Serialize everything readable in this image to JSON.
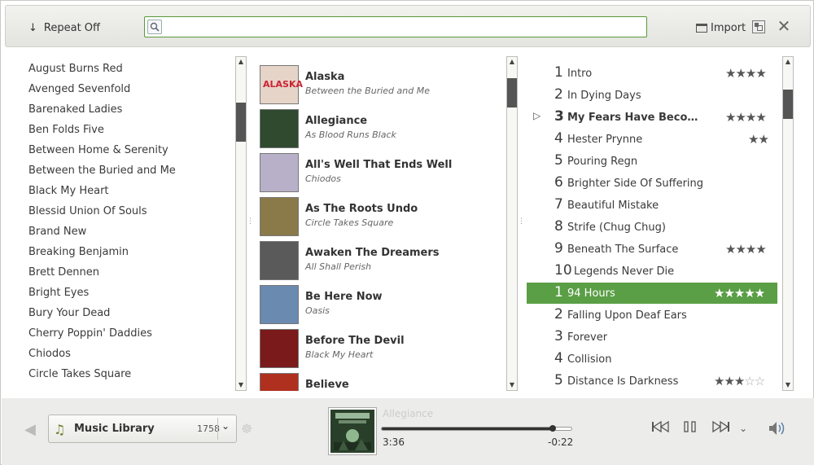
{
  "toolbar": {
    "repeat_label": "Repeat Off",
    "search_placeholder": "",
    "import_label": "Import"
  },
  "artists": [
    "August Burns Red",
    "Avenged Sevenfold",
    "Barenaked Ladies",
    "Ben Folds Five",
    "Between Home & Serenity",
    "Between the Buried and Me",
    "Black My Heart",
    "Blessid Union Of Souls",
    "Brand New",
    "Breaking Benjamin",
    "Brett Dennen",
    "Bright Eyes",
    "Bury Your Dead",
    "Cherry Poppin' Daddies",
    "Chiodos",
    "Circle Takes Square"
  ],
  "albums": [
    {
      "name": "Alaska",
      "artist": "Between the Buried and Me",
      "cover_color": "#e6d4c8",
      "cover_text": "ALASKA"
    },
    {
      "name": "Allegiance",
      "artist": "As Blood Runs Black",
      "cover_color": "#2f4a2f",
      "cover_text": ""
    },
    {
      "name": "All's Well That Ends Well",
      "artist": "Chiodos",
      "cover_color": "#b8b0c8",
      "cover_text": ""
    },
    {
      "name": "As The Roots Undo",
      "artist": "Circle Takes Square",
      "cover_color": "#8a7a4a",
      "cover_text": ""
    },
    {
      "name": "Awaken The Dreamers",
      "artist": "All Shall Perish",
      "cover_color": "#5a5a5a",
      "cover_text": ""
    },
    {
      "name": "Be Here Now",
      "artist": "Oasis",
      "cover_color": "#6a8ab0",
      "cover_text": ""
    },
    {
      "name": "Before The Devil",
      "artist": "Black My Heart",
      "cover_color": "#7a1a1a",
      "cover_text": ""
    },
    {
      "name": "Believe",
      "artist": "",
      "cover_color": "#b03020",
      "cover_text": ""
    }
  ],
  "tracks": [
    {
      "num": "1",
      "title": "Intro",
      "rating": 4,
      "max": 4
    },
    {
      "num": "2",
      "title": "In Dying Days",
      "rating": 0,
      "max": 0
    },
    {
      "num": "3",
      "title": "My Fears Have Become Phobias",
      "rating": 4,
      "max": 4,
      "playing": true
    },
    {
      "num": "4",
      "title": "Hester Prynne",
      "rating": 2,
      "max": 2
    },
    {
      "num": "5",
      "title": "Pouring Regn",
      "rating": 0,
      "max": 0
    },
    {
      "num": "6",
      "title": "Brighter Side Of Suffering",
      "rating": 0,
      "max": 0
    },
    {
      "num": "7",
      "title": "Beautiful Mistake",
      "rating": 0,
      "max": 0
    },
    {
      "num": "8",
      "title": "Strife (Chug Chug)",
      "rating": 0,
      "max": 0
    },
    {
      "num": "9",
      "title": "Beneath The Surface",
      "rating": 4,
      "max": 4
    },
    {
      "num": "10",
      "title": "Legends Never Die",
      "rating": 0,
      "max": 0
    },
    {
      "num": "1",
      "title": "94 Hours",
      "rating": 5,
      "max": 5,
      "selected": true
    },
    {
      "num": "2",
      "title": "Falling Upon Deaf Ears",
      "rating": 0,
      "max": 0
    },
    {
      "num": "3",
      "title": "Forever",
      "rating": 0,
      "max": 0
    },
    {
      "num": "4",
      "title": "Collision",
      "rating": 0,
      "max": 0
    },
    {
      "num": "5",
      "title": "Distance Is Darkness",
      "rating": 3,
      "max": 5
    }
  ],
  "source": {
    "label": "Music Library",
    "count": "1758"
  },
  "now_playing": {
    "title": "Allegiance",
    "elapsed": "3:36",
    "remaining": "-0:22",
    "progress": 0.9
  },
  "colors": {
    "accent": "#5a9e45",
    "search_border": "#5a9a3a"
  }
}
